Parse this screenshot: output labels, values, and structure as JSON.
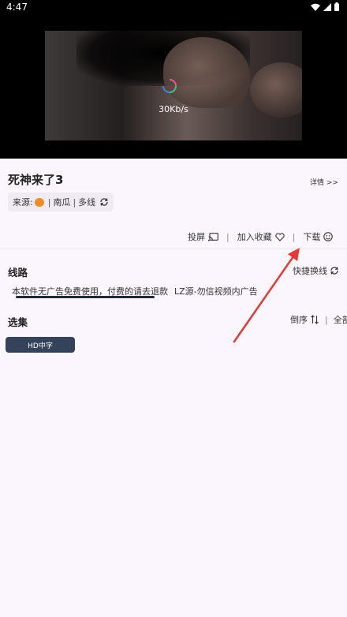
{
  "status_bar": {
    "time": "4:47"
  },
  "player": {
    "speed": "30Kb/s"
  },
  "video": {
    "title": "死神来了3",
    "detail_link": "详情 >>",
    "source": {
      "prefix": "来源:",
      "name": "南瓜",
      "route": "多线"
    }
  },
  "actions": {
    "cast": "投屏",
    "favorite": "加入收藏",
    "download": "下载"
  },
  "routes": {
    "title": "线路",
    "quick_switch": "快捷换线",
    "tabs": [
      "本软件无广告免费使用，付费的请去退款",
      "LZ源-勿信视频内广告"
    ]
  },
  "episodes": {
    "title": "选集",
    "order": "倒序",
    "all": "全部",
    "items": [
      "HD中字"
    ]
  },
  "colors": {
    "accent": "#34435a",
    "annotation_arrow": "#e53935"
  }
}
